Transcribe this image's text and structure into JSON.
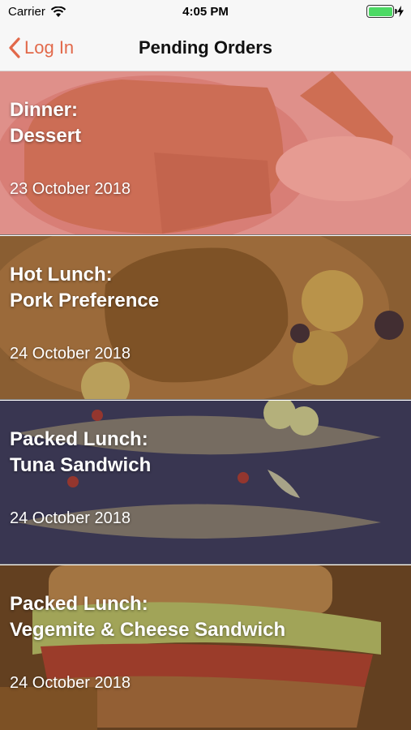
{
  "status_bar": {
    "carrier": "Carrier",
    "time": "4:05 PM",
    "battery_level": 1.0
  },
  "nav": {
    "back_label": "Log In",
    "title": "Pending Orders"
  },
  "colors": {
    "accent": "#e2694a",
    "card_tints": [
      "#d8686a",
      "#8a5a2e",
      "#3f3a57",
      "#7a4f2a"
    ]
  },
  "orders": [
    {
      "title_line1": "Dinner:",
      "title_line2": "Dessert",
      "date": "23 October 2018",
      "icon": "dessert-photo"
    },
    {
      "title_line1": "Hot Lunch:",
      "title_line2": "Pork Preference",
      "date": "24 October 2018",
      "icon": "pork-roast-photo"
    },
    {
      "title_line1": "Packed Lunch:",
      "title_line2": "Tuna Sandwich",
      "date": "24 October 2018",
      "icon": "fish-photo"
    },
    {
      "title_line1": "Packed Lunch:",
      "title_line2": "Vegemite & Cheese Sandwich",
      "date": "24 October 2018",
      "icon": "sandwich-photo"
    }
  ]
}
